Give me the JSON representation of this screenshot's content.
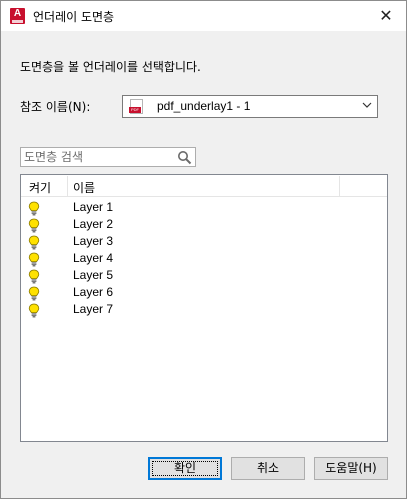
{
  "window": {
    "title": "언더레이 도면층",
    "app_icon_letter": "A",
    "close_glyph": "✕"
  },
  "instruction": "도면층을 볼 언더레이를 선택합니다.",
  "reference": {
    "label": "참조 이름(N):",
    "selected": "pdf_underlay1 - 1",
    "file_icon": "pdf-file-icon",
    "file_tag": "PDF"
  },
  "search": {
    "placeholder": "도면층 검색",
    "value": ""
  },
  "layer_list": {
    "columns": [
      "켜기",
      "이름"
    ],
    "layers": [
      {
        "name": "Layer 1",
        "on": true
      },
      {
        "name": "Layer 2",
        "on": true
      },
      {
        "name": "Layer 3",
        "on": true
      },
      {
        "name": "Layer 4",
        "on": true
      },
      {
        "name": "Layer 5",
        "on": true
      },
      {
        "name": "Layer 6",
        "on": true
      },
      {
        "name": "Layer 7",
        "on": true
      }
    ]
  },
  "buttons": {
    "ok": "확인",
    "cancel": "취소",
    "help": "도움말(H)"
  },
  "colors": {
    "accent": "#0078d7",
    "brand": "#c8102e",
    "bulb_on": "#ffe100"
  }
}
